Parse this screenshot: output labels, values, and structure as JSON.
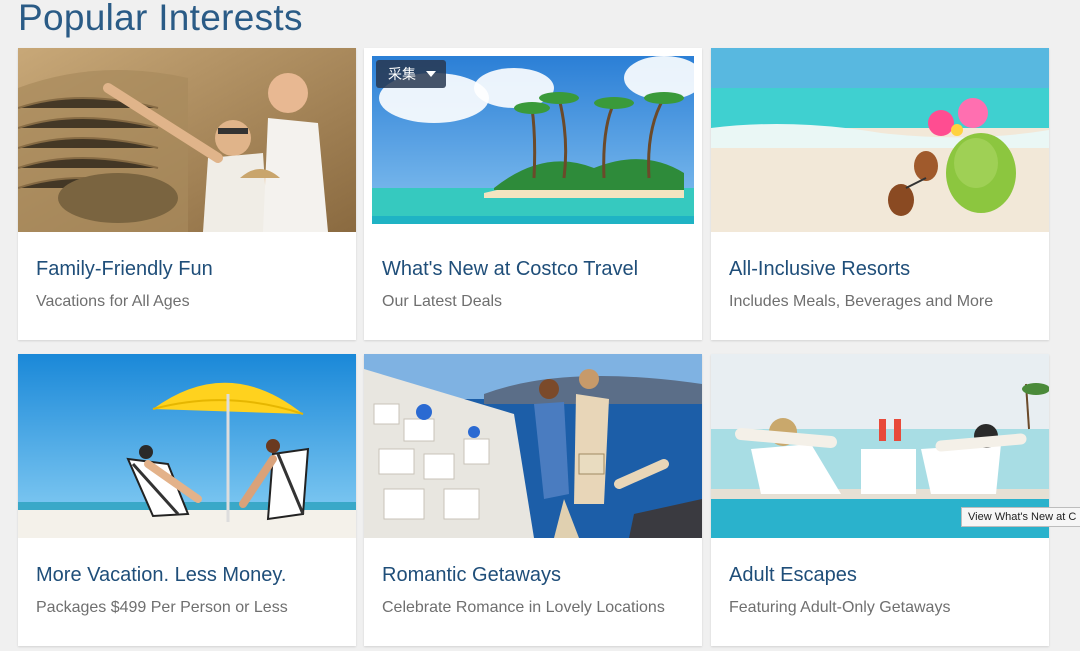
{
  "header": {
    "title": "Popular Interests"
  },
  "cards": [
    {
      "title": "Family-Friendly Fun",
      "subtitle": "Vacations for All Ages",
      "image_icon": "family-photo"
    },
    {
      "title": "What's New at Costco Travel",
      "subtitle": "Our Latest Deals",
      "image_icon": "island-photo",
      "overlay_button": "采集"
    },
    {
      "title": "All-Inclusive Resorts",
      "subtitle": "Includes Meals, Beverages and More",
      "image_icon": "coconut-beach-photo"
    },
    {
      "title": "More Vacation. Less Money.",
      "subtitle": "Packages $499 Per Person or Less",
      "image_icon": "umbrella-beach-photo"
    },
    {
      "title": "Romantic Getaways",
      "subtitle": "Celebrate Romance in Lovely Locations",
      "image_icon": "santorini-couple-photo"
    },
    {
      "title": "Adult Escapes",
      "subtitle": "Featuring Adult-Only Getaways",
      "image_icon": "pool-lounge-photo"
    }
  ],
  "tooltip": {
    "text": "View What's New at C"
  },
  "colors": {
    "title": "#2a5b86",
    "card_title": "#1f4e79",
    "subtitle": "#6f6f6f",
    "background": "#f0f0f0"
  }
}
